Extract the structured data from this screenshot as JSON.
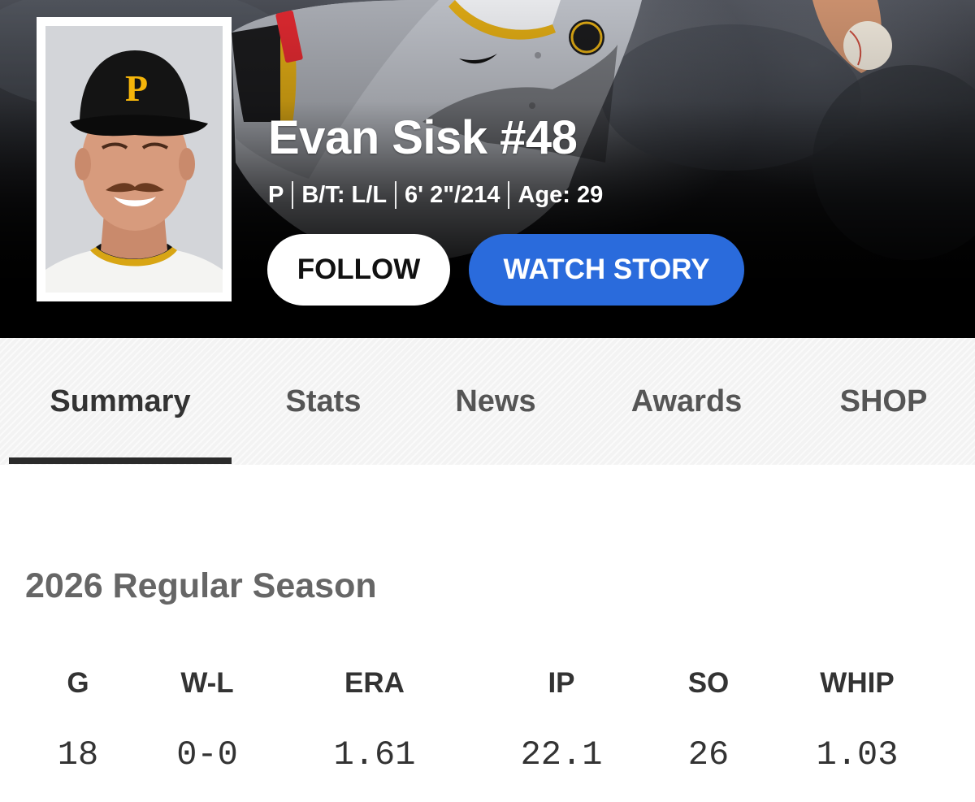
{
  "player": {
    "name": "Evan Sisk #48",
    "bio": [
      "P",
      "B/T: L/L",
      "6' 2\"/214",
      "Age: 29"
    ]
  },
  "actions": {
    "follow_label": "FOLLOW",
    "watch_label": "WATCH STORY"
  },
  "tabs": [
    {
      "label": "Summary",
      "active": true
    },
    {
      "label": "Stats",
      "active": false
    },
    {
      "label": "News",
      "active": false
    },
    {
      "label": "Awards",
      "active": false
    },
    {
      "label": "SHOP",
      "active": false
    }
  ],
  "season": {
    "title": "2026 Regular Season",
    "stats": [
      {
        "label": "G",
        "value": "18"
      },
      {
        "label": "W-L",
        "value": "0-0"
      },
      {
        "label": "ERA",
        "value": "1.61"
      },
      {
        "label": "IP",
        "value": "22.1"
      },
      {
        "label": "SO",
        "value": "26"
      },
      {
        "label": "WHIP",
        "value": "1.03"
      }
    ]
  },
  "colors": {
    "accent_blue": "#2a6bdc",
    "team_gold": "#f5b50a",
    "team_black": "#111111"
  }
}
